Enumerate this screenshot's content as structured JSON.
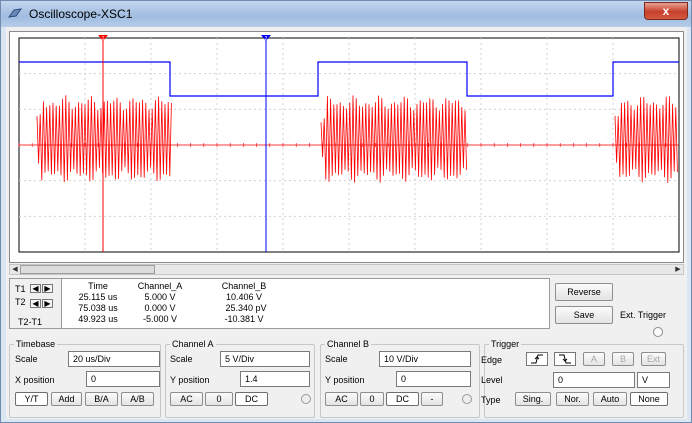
{
  "window": {
    "title": "Oscilloscope-XSC1",
    "close_glyph": "x"
  },
  "colors": {
    "channel_a": "#ff0000",
    "channel_b": "#0000ff",
    "grid": "#d0d0d0"
  },
  "cursors": {
    "t1_label": "T1",
    "t2_label": "T2",
    "diff_label": "T2-T1",
    "t1_marker": "1",
    "t2_marker": "2"
  },
  "readout": {
    "headers": {
      "time": "Time",
      "channel_a": "Channel_A",
      "channel_b": "Channel_B"
    },
    "rows": [
      {
        "time": "25.115 us",
        "channel_a": "5.000 V",
        "channel_b": "10.406 V"
      },
      {
        "time": "75.038 us",
        "channel_a": "0.000 V",
        "channel_b": "25.340  pV"
      },
      {
        "time": "49.923 us",
        "channel_a": "-5.000 V",
        "channel_b": "-10.381 V"
      }
    ]
  },
  "buttons": {
    "reverse": "Reverse",
    "save": "Save",
    "ext_trigger": "Ext. Trigger"
  },
  "timebase": {
    "legend": "Timebase",
    "scale_label": "Scale",
    "scale_value": "20 us/Div",
    "xpos_label": "X position",
    "xpos_value": "0",
    "modes": [
      "Y/T",
      "Add",
      "B/A",
      "A/B"
    ]
  },
  "channel_a": {
    "legend": "Channel A",
    "scale_label": "Scale",
    "scale_value": "5  V/Div",
    "ypos_label": "Y position",
    "ypos_value": "1.4",
    "coupling": [
      "AC",
      "0",
      "DC"
    ]
  },
  "channel_b": {
    "legend": "Channel B",
    "scale_label": "Scale",
    "scale_value": "10  V/Div",
    "ypos_label": "Y position",
    "ypos_value": "0",
    "coupling": [
      "AC",
      "0",
      "DC",
      "-"
    ]
  },
  "trigger": {
    "legend": "Trigger",
    "edge_label": "Edge",
    "level_label": "Level",
    "level_value": "0",
    "level_unit": "V",
    "type_label": "Type",
    "sources": [
      "A",
      "B",
      "Ext"
    ],
    "types": [
      "Sing.",
      "Nor.",
      "Auto",
      "None"
    ]
  }
}
